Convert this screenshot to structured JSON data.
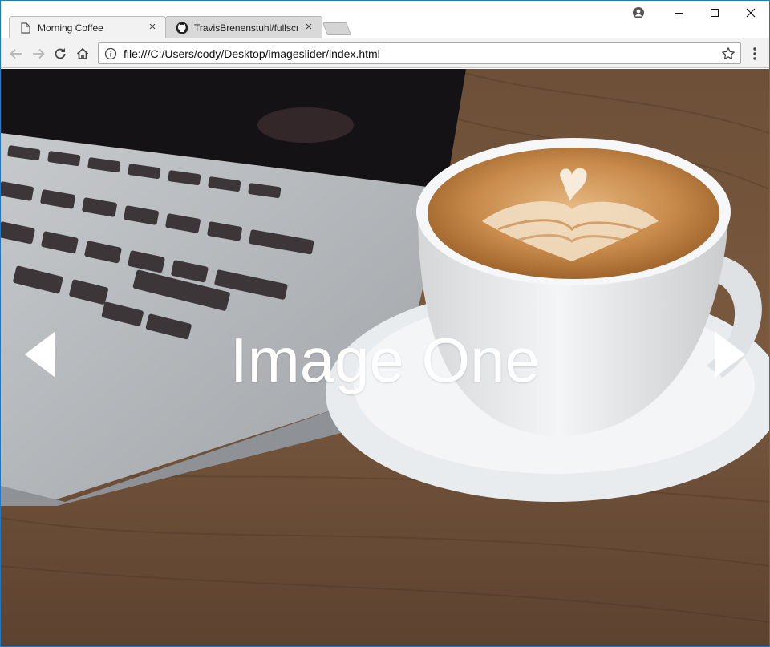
{
  "tabs": [
    {
      "title": "Morning Coffee",
      "icon": "page-icon",
      "close": "×"
    },
    {
      "title": "TravisBrenenstuhl/fullscre",
      "icon": "github-icon",
      "close": "×"
    }
  ],
  "window_controls": {
    "minimize": "—",
    "maximize": "☐",
    "close": "✕"
  },
  "address_bar": {
    "url": "file:///C:/Users/cody/Desktop/imageslider/index.html"
  },
  "slider": {
    "caption": "Image One",
    "prev_icon": "arrow-left-icon",
    "next_icon": "arrow-right-icon"
  },
  "colors": {
    "window_border": "#1e78c8",
    "toolbar": "#f2f2f2",
    "caption": "#ffffff"
  }
}
